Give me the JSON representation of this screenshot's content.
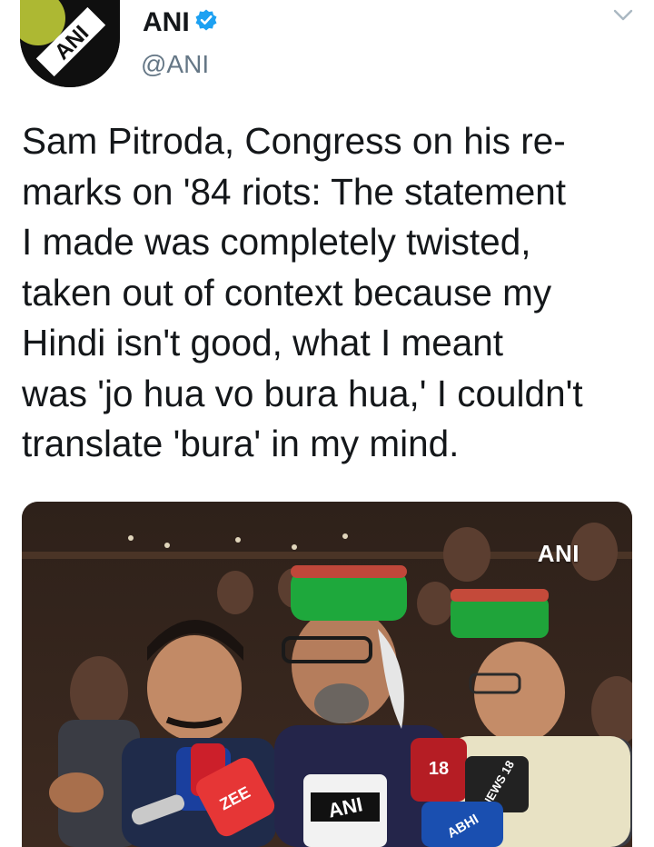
{
  "tweet": {
    "author": {
      "name": "ANI",
      "handle": "@ANI",
      "verified": true,
      "avatar_text": "ANI"
    },
    "text": "Sam Pitroda, Congress on his re-\nmarks on '84 riots: The statement\nI made was completely twisted,\ntaken out of context because my\nHindi isn't good, what I meant\nwas 'jo hua vo bura hua,' I couldn't\ntranslate 'bura' in my mind.",
    "media": {
      "watermark": "ANI",
      "mic_labels": [
        "ZEE",
        "ANI",
        "NEWS 18",
        "18",
        "ABHI"
      ]
    }
  },
  "icons": {
    "verified": "verified-badge-icon",
    "menu": "chevron-down-icon"
  },
  "colors": {
    "verified_blue": "#1da1f2",
    "text": "#14171a",
    "secondary": "#657786"
  }
}
